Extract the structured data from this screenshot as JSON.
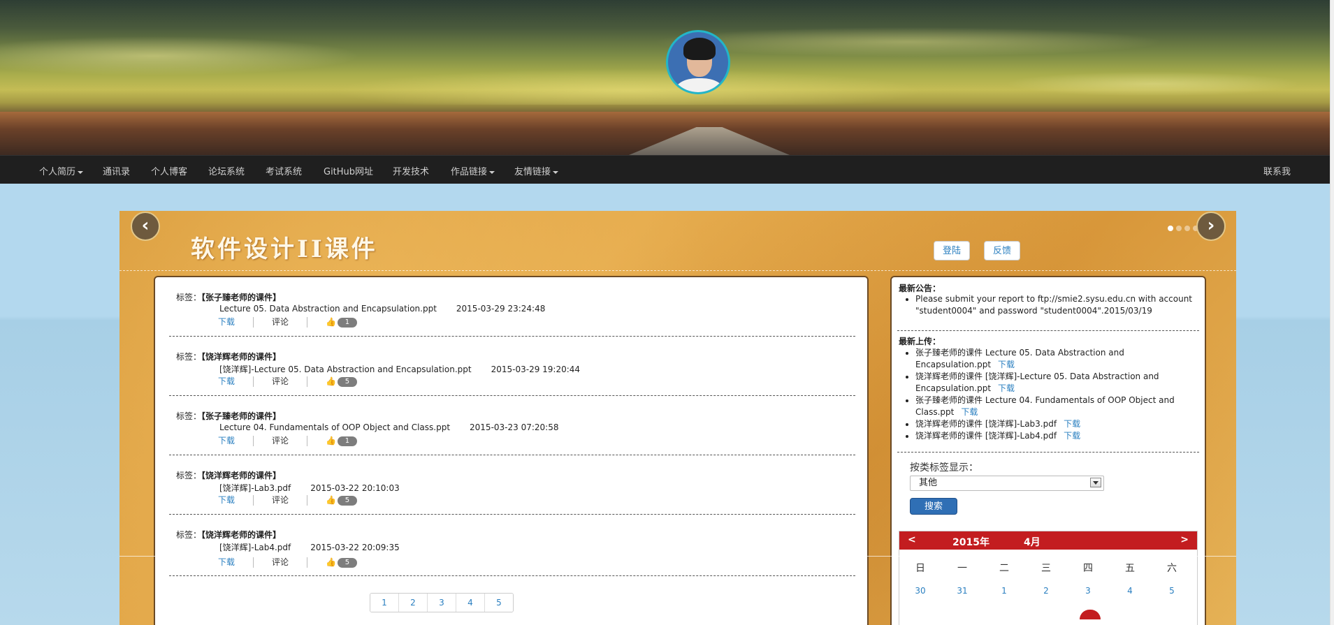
{
  "nav": {
    "items": [
      {
        "label": "个人简历",
        "dropdown": true
      },
      {
        "label": "通讯录",
        "dropdown": false
      },
      {
        "label": "个人博客",
        "dropdown": false
      },
      {
        "label": "论坛系统",
        "dropdown": false
      },
      {
        "label": "考试系统",
        "dropdown": false
      },
      {
        "label": "GitHub网址",
        "dropdown": false
      },
      {
        "label": "开发技术",
        "dropdown": false
      },
      {
        "label": "作品链接",
        "dropdown": true
      },
      {
        "label": "友情链接",
        "dropdown": true
      }
    ],
    "contact": "联系我"
  },
  "slide": {
    "title": "软件设计II课件",
    "login_button": "登陆",
    "feedback_button": "反馈",
    "prev_arrow": "‹",
    "next_arrow": "›",
    "dot_count": 6
  },
  "entries": [
    {
      "tag_label": "标签：",
      "tag": "【张子臻老师的课件】",
      "file": "Lecture 05. Data Abstraction and Encapsulation.ppt",
      "date": "2015-03-29 23:24:48",
      "download": "下载",
      "comment": "评论",
      "likes": "1"
    },
    {
      "tag_label": "标签：",
      "tag": "【饶洋辉老师的课件】",
      "file": "[饶洋辉]-Lecture 05. Data Abstraction and Encapsulation.ppt",
      "date": "2015-03-29 19:20:44",
      "download": "下载",
      "comment": "评论",
      "likes": "5"
    },
    {
      "tag_label": "标签：",
      "tag": "【张子臻老师的课件】",
      "file": "Lecture 04. Fundamentals of OOP Object and Class.ppt",
      "date": "2015-03-23 07:20:58",
      "download": "下载",
      "comment": "评论",
      "likes": "1"
    },
    {
      "tag_label": "标签：",
      "tag": "【饶洋辉老师的课件】",
      "file": "[饶洋辉]-Lab3.pdf",
      "date": "2015-03-22 20:10:03",
      "download": "下载",
      "comment": "评论",
      "likes": "5"
    },
    {
      "tag_label": "标签：",
      "tag": "【饶洋辉老师的课件】",
      "file": "[饶洋辉]-Lab4.pdf",
      "date": "2015-03-22 20:09:35",
      "download": "下载",
      "comment": "评论",
      "likes": "5"
    }
  ],
  "pagination": [
    "1",
    "2",
    "3",
    "4",
    "5"
  ],
  "sidebar": {
    "announce_title": "最新公告：",
    "announcement": "Please submit your report to ftp://smie2.sysu.edu.cn with account \"student0004\" and password \"student0004\".2015/03/19",
    "uploads_title": "最新上传：",
    "uploads": [
      {
        "text": "张子臻老师的课件  Lecture 05. Data Abstraction and Encapsulation.ppt",
        "link": "下载"
      },
      {
        "text": "饶洋辉老师的课件  [饶洋辉]-Lecture 05. Data Abstraction and Encapsulation.ppt",
        "link": "下载"
      },
      {
        "text": "张子臻老师的课件  Lecture 04. Fundamentals of OOP Object and Class.ppt",
        "link": "下载"
      },
      {
        "text": "饶洋辉老师的课件  [饶洋辉]-Lab3.pdf",
        "link": "下载"
      },
      {
        "text": "饶洋辉老师的课件  [饶洋辉]-Lab4.pdf",
        "link": "下载"
      }
    ],
    "filter_label": "按类标签显示：",
    "filter_value": "其他",
    "search_button": "搜索"
  },
  "calendar": {
    "prev": "<",
    "next": ">",
    "year": "2015年",
    "month": "4月",
    "weekdays": [
      "日",
      "一",
      "二",
      "三",
      "四",
      "五",
      "六"
    ],
    "first_row": [
      "30",
      "31",
      "1",
      "2",
      "3",
      "4",
      "5"
    ],
    "accent": "#c31d20"
  },
  "colors": {
    "navbar": "#1f1f1f",
    "page_background": "#b3d7ec",
    "link": "#2a7fc0",
    "slide_background": "#e0a546"
  }
}
